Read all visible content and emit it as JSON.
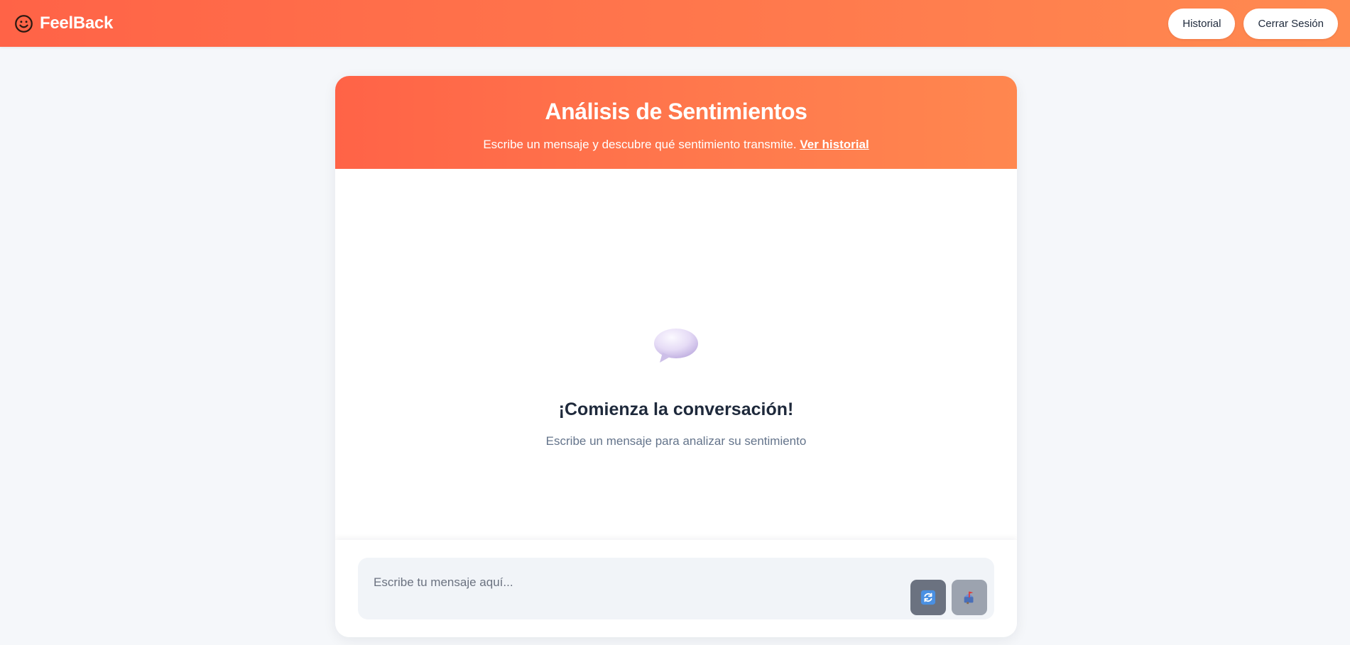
{
  "navbar": {
    "brand_name": "FeelBack",
    "brand_icon": "smiley-face-icon",
    "history_button": "Historial",
    "logout_button": "Cerrar Sesión"
  },
  "header": {
    "title": "Análisis de Sentimientos",
    "subtitle": "Escribe un mensaje y descubre qué sentimiento transmite.",
    "history_link": "Ver historial"
  },
  "empty_state": {
    "icon": "speech-bubble-icon",
    "title": "¡Comienza la conversación!",
    "subtitle": "Escribe un mensaje para analizar su sentimiento"
  },
  "composer": {
    "placeholder": "Escribe tu mensaje aquí...",
    "value": "",
    "refresh_icon": "refresh-icon",
    "send_icon": "send-mailbox-icon"
  },
  "colors": {
    "brand_orange": "#ff6347",
    "brand_orange_light": "#ff8a50",
    "page_background": "#f5f7fa",
    "input_background": "#f1f4f8",
    "refresh_button": "#6b7280",
    "send_button": "#9ca3af"
  }
}
